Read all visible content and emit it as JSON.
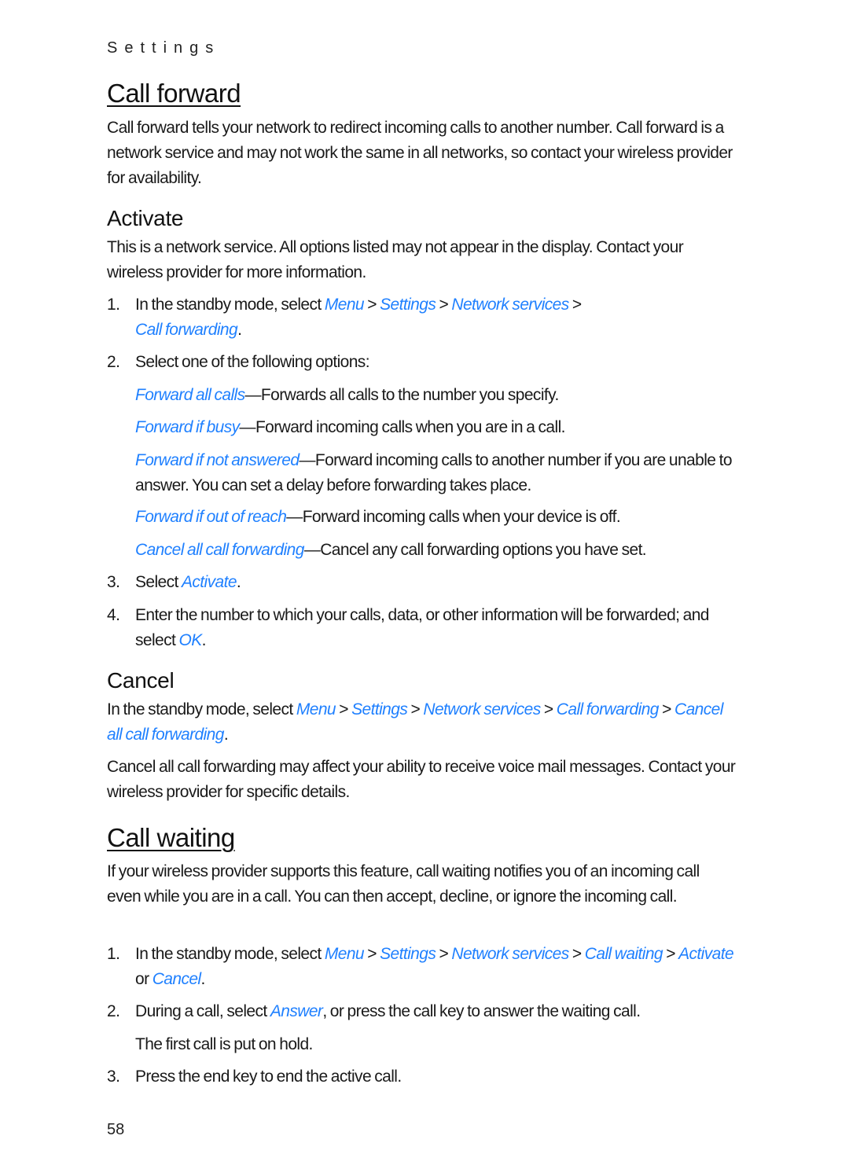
{
  "running_head": "Settings",
  "page_number": "58",
  "link_color": "#1f80ff",
  "call_forward": {
    "title": "Call forward",
    "intro": "Call forward tells your network to redirect incoming calls to another number. Call forward is a network service and may not work the same in all networks, so contact your wireless provider for availability.",
    "activate": {
      "title": "Activate",
      "intro": "This is a network service. All options listed may not appear in the display. Contact your wireless provider for more information.",
      "step1": {
        "num": "1.",
        "prefix": "In the standby mode, select ",
        "path": [
          "Menu",
          "Settings",
          "Network services",
          "Call forwarding"
        ],
        "sep": " > ",
        "suffix": "."
      },
      "step2": {
        "num": "2.",
        "text": "Select one of the following options:"
      },
      "options": [
        {
          "name": "Forward all calls",
          "desc": "—Forwards all calls to the number you specify."
        },
        {
          "name": "Forward if busy",
          "desc": "—Forward incoming calls when you are in a call."
        },
        {
          "name": "Forward if not answered",
          "desc": "—Forward incoming calls to another number if you are unable to answer. You can set a delay before forwarding takes place."
        },
        {
          "name": "Forward if out of reach",
          "desc": "—Forward incoming calls when your device is off."
        },
        {
          "name": "Cancel all call forwarding",
          "desc": "—Cancel any call forwarding options you have set."
        }
      ],
      "step3": {
        "num": "3.",
        "prefix": "Select ",
        "link": "Activate",
        "suffix": "."
      },
      "step4": {
        "num": "4.",
        "prefix": "Enter the number to which your calls, data, or other information will be forwarded; and select ",
        "link": "OK",
        "suffix": "."
      }
    },
    "cancel": {
      "title": "Cancel",
      "prefix": "In the standby mode, select ",
      "path": [
        "Menu",
        "Settings",
        "Network services",
        "Call forwarding",
        "Cancel all call forwarding"
      ],
      "suffix": ".",
      "note": "Cancel all call forwarding may affect your ability to receive voice mail messages. Contact your wireless provider for specific details."
    }
  },
  "call_waiting": {
    "title": "Call waiting",
    "intro": "If your wireless provider supports this feature, call waiting notifies you of an incoming call even while you are in a call. You can then accept, decline, or ignore the incoming call.",
    "step1": {
      "num": "1.",
      "prefix": "In the standby mode, select ",
      "path": [
        "Menu",
        "Settings",
        "Network services",
        "Call waiting"
      ],
      "link_activate": "Activate",
      "or": " or ",
      "link_cancel": "Cancel",
      "suffix": "."
    },
    "step2": {
      "num": "2.",
      "prefix": "During a call, select ",
      "link": "Answer",
      "suffix": ", or press the call key to answer the waiting call.",
      "note": "The first call is put on hold."
    },
    "step3": {
      "num": "3.",
      "text": "Press the end key to end the active call."
    }
  }
}
